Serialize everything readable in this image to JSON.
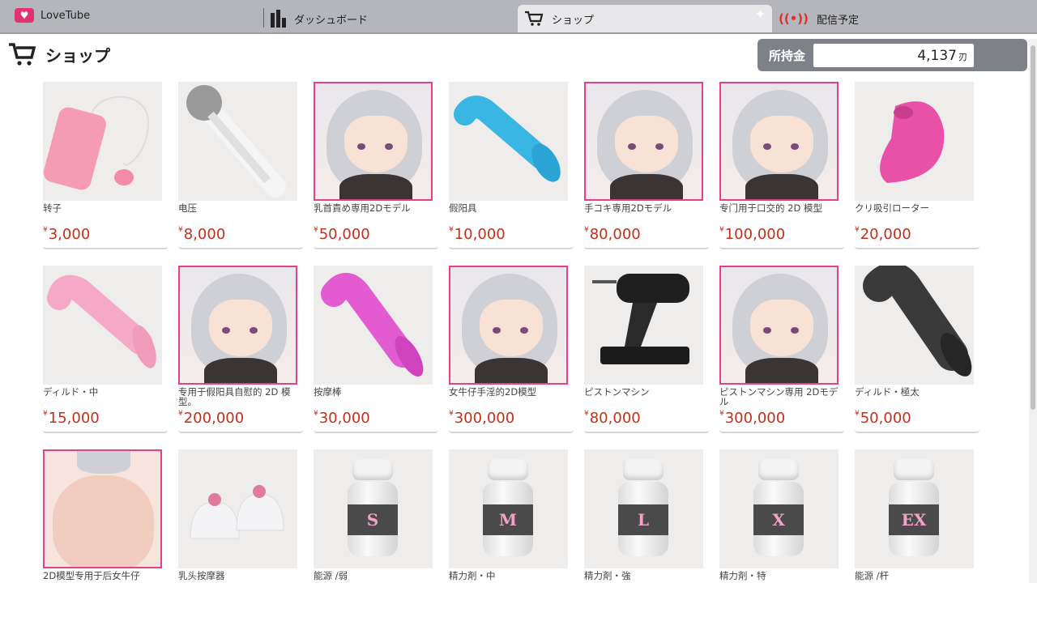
{
  "nav": {
    "brand": "LoveTube",
    "dashboard": "ダッシュボード",
    "shop": "ショップ",
    "live": "配信予定"
  },
  "header": {
    "title": "ショップ",
    "wallet_label": "所持金",
    "wallet_value": "4,137",
    "wallet_unit": "刃"
  },
  "items": [
    {
      "name": "转子",
      "price": "3,000"
    },
    {
      "name": "电压",
      "price": "8,000"
    },
    {
      "name": "乳首責め専用2Dモデル",
      "price": "50,000"
    },
    {
      "name": "假阳具",
      "price": "10,000"
    },
    {
      "name": "手コキ専用2Dモデル",
      "price": "80,000"
    },
    {
      "name": "专门用于口交的 2D 模型",
      "price": "100,000"
    },
    {
      "name": "クリ吸引ローター",
      "price": "20,000"
    },
    {
      "name": "ディルド・中",
      "price": "15,000"
    },
    {
      "name": "专用于假阳具自慰的 2D 模型。",
      "price": "200,000"
    },
    {
      "name": "按摩棒",
      "price": "30,000"
    },
    {
      "name": "女牛仔手淫的2D模型",
      "price": "300,000"
    },
    {
      "name": "ピストンマシン",
      "price": "80,000"
    },
    {
      "name": "ピストンマシン専用 2Dモデル",
      "price": "300,000"
    },
    {
      "name": "ディルド・極太",
      "price": "50,000"
    },
    {
      "name": "2D模型专用于后女牛仔",
      "price": ""
    },
    {
      "name": "乳头按摩器",
      "price": ""
    },
    {
      "name": "能源 /弱",
      "price": "",
      "label": "S"
    },
    {
      "name": "精力剤・中",
      "price": "",
      "label": "M"
    },
    {
      "name": "精力剤・強",
      "price": "",
      "label": "L"
    },
    {
      "name": "精力剤・特",
      "price": "",
      "label": "X"
    },
    {
      "name": "能源 /杆",
      "price": "",
      "label": "EX"
    }
  ],
  "currency_symbol": "¥"
}
